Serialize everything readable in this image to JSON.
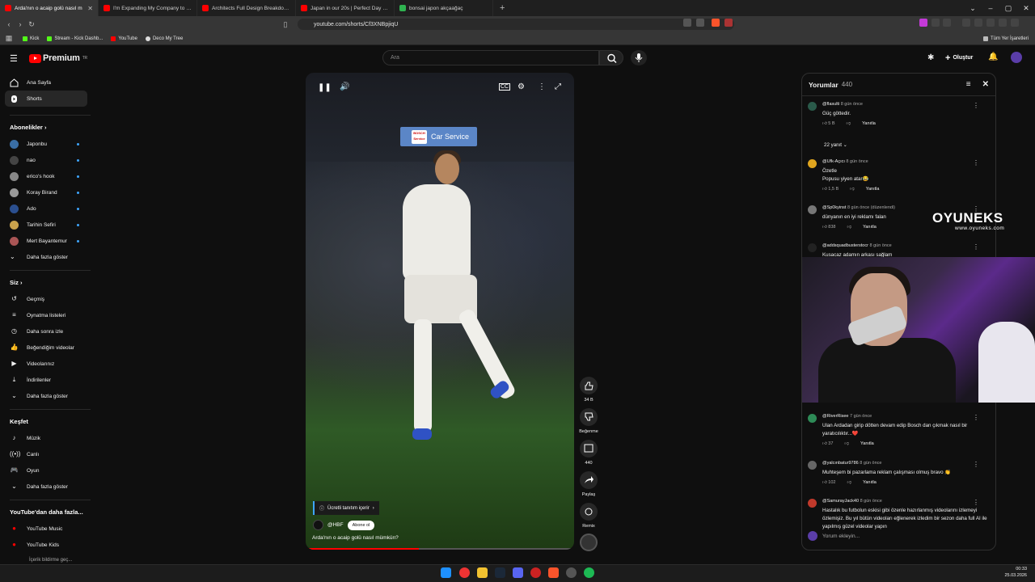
{
  "browser": {
    "tabs": [
      {
        "title": "Arda'nın o acaip golü nasıl m",
        "active": true,
        "color": "#ff0000"
      },
      {
        "title": "I'm Expanding My Company to New",
        "active": false,
        "color": "#ff0000"
      },
      {
        "title": "Architects Full Design Breakdown of",
        "active": false,
        "color": "#ff0000"
      },
      {
        "title": "Japan in our 20s | Perfect Day out in",
        "active": false,
        "color": "#ff0000"
      },
      {
        "title": "bonsai japon akçaağaç",
        "active": false,
        "color": "#2fb350"
      }
    ],
    "url": "youtube.com/shorts/Cf3XNBpjiqU",
    "bookmarks": [
      {
        "label": "Kick",
        "color": "#53fc18"
      },
      {
        "label": "Stream - Kick Dashb...",
        "color": "#53fc18"
      },
      {
        "label": "YouTube",
        "color": "#ff0000"
      },
      {
        "label": "Deco My Tree",
        "color": "#dddddd"
      }
    ],
    "all_bookmarks": "Tüm Yer İşaretleri"
  },
  "youtube": {
    "logo_text": "Premium",
    "region": "TR",
    "search_placeholder": "Ara",
    "create_label": "Oluştur"
  },
  "sidebar": {
    "main": [
      {
        "label": "Ana Sayfa",
        "icon": "home-icon"
      },
      {
        "label": "Shorts",
        "icon": "shorts-icon",
        "active": true
      }
    ],
    "subs_header": "Abonelikler",
    "subs": [
      {
        "label": "Japonbu",
        "color": "#3a6ea5"
      },
      {
        "label": "nao",
        "color": "#444"
      },
      {
        "label": "erico's hook",
        "color": "#888"
      },
      {
        "label": "Koray Birand",
        "color": "#999"
      },
      {
        "label": "Ado",
        "color": "#2b4f8f"
      },
      {
        "label": "Tarihin Sefiri",
        "color": "#c9a24c"
      },
      {
        "label": "Mert Bayantemur",
        "color": "#a55"
      }
    ],
    "subs_more": "Daha fazla göster",
    "you_header": "Siz",
    "you": [
      {
        "label": "Geçmiş",
        "icon": "history-icon"
      },
      {
        "label": "Oynatma listeleri",
        "icon": "playlist-icon"
      },
      {
        "label": "Daha sonra izle",
        "icon": "clock-icon"
      },
      {
        "label": "Beğendiğim videolar",
        "icon": "like-icon"
      },
      {
        "label": "Videolarınız",
        "icon": "video-icon"
      },
      {
        "label": "İndirilenler",
        "icon": "download-icon"
      },
      {
        "label": "Daha fazla göster",
        "icon": "chevron-down-icon"
      }
    ],
    "explore_header": "Keşfet",
    "explore": [
      {
        "label": "Müzik",
        "icon": "music-icon"
      },
      {
        "label": "Canlı",
        "icon": "live-icon"
      },
      {
        "label": "Oyun",
        "icon": "gaming-icon"
      },
      {
        "label": "Daha fazla göster",
        "icon": "chevron-down-icon"
      }
    ],
    "more_header": "YouTube'dan daha fazla...",
    "more": [
      {
        "label": "YouTube Music",
        "icon": "yt-music-icon"
      },
      {
        "label": "YouTube Kids",
        "icon": "yt-kids-icon"
      }
    ],
    "bottom_cut": "İçerik bildirme geç..."
  },
  "video": {
    "sponsor_logo": "BOSCH Service",
    "sponsor_text": "Car Service",
    "paid_promo": "Ücretli tanıtım içerir",
    "channel": "@HBF",
    "subscribe": "Abone ol",
    "title": "Arda'nın o acaip golü nasıl mümkün?",
    "progress": 0.42
  },
  "actions": {
    "like_count": "34 B",
    "dislike_label": "Beğenme",
    "comment_count": "440",
    "share_label": "Paylaş",
    "remix_label": "Remix"
  },
  "comments": {
    "title": "Yorumlar",
    "count": "440",
    "replies_toggle": "22 yanıt",
    "reply_label": "Yanıtla",
    "add_placeholder": "Yorum ekleyin...",
    "items": [
      {
        "user": "@flasulti",
        "when": "8 gün önce",
        "text": "Güç göttedir.",
        "likes": "5 B",
        "color": "#2a5a4a"
      },
      {
        "user": "@Ufk-Açıcı",
        "when": "8 gün önce",
        "text": "Özetle\nPopusu yiyen atar😂",
        "likes": "1,5 B",
        "color": "#e0a51e"
      },
      {
        "user": "@Sp0kyinst",
        "when": "8 gün önce (düzenlendi)",
        "text": "dünyanın en iyi reklamı falan",
        "likes": "838",
        "color": "#777"
      },
      {
        "user": "@addsquadbusterstocr",
        "when": "8 gün önce",
        "text": "Kusacaz adamın arkası sağlam",
        "likes": "",
        "color": "#222"
      },
      {
        "user": "@RiverRisee",
        "when": "7 gün önce",
        "text": "Ulan Ardadan girip dötten devam edip Bosch dan çıkmak nasıl bir yaratıcılıktır...❤️",
        "likes": "37",
        "color": "#2e8b57"
      },
      {
        "user": "@yalcınbatur9786",
        "when": "8 gün önce",
        "text": "Muhteşem bi pazarlama reklam çalışması olmuş bravo 👏",
        "likes": "102",
        "color": "#666"
      },
      {
        "user": "@SamurayJack40",
        "when": "8 gün önce",
        "text": "Hastalık bu futbolun eskisi gibi özenle hazırlanmış videolarını izlemeyi özlemişiz. Bu yıl bütün videoları eğlenerek izledim bir sezon daha full AI ile yapılmış güzel videolar yapın",
        "likes": "",
        "color": "#c0392b"
      }
    ]
  },
  "overlay": {
    "brand": "OYUNEKS",
    "url": "www.oyuneks.com"
  },
  "clock": {
    "time": "00:33",
    "date": "25.03.2026"
  }
}
